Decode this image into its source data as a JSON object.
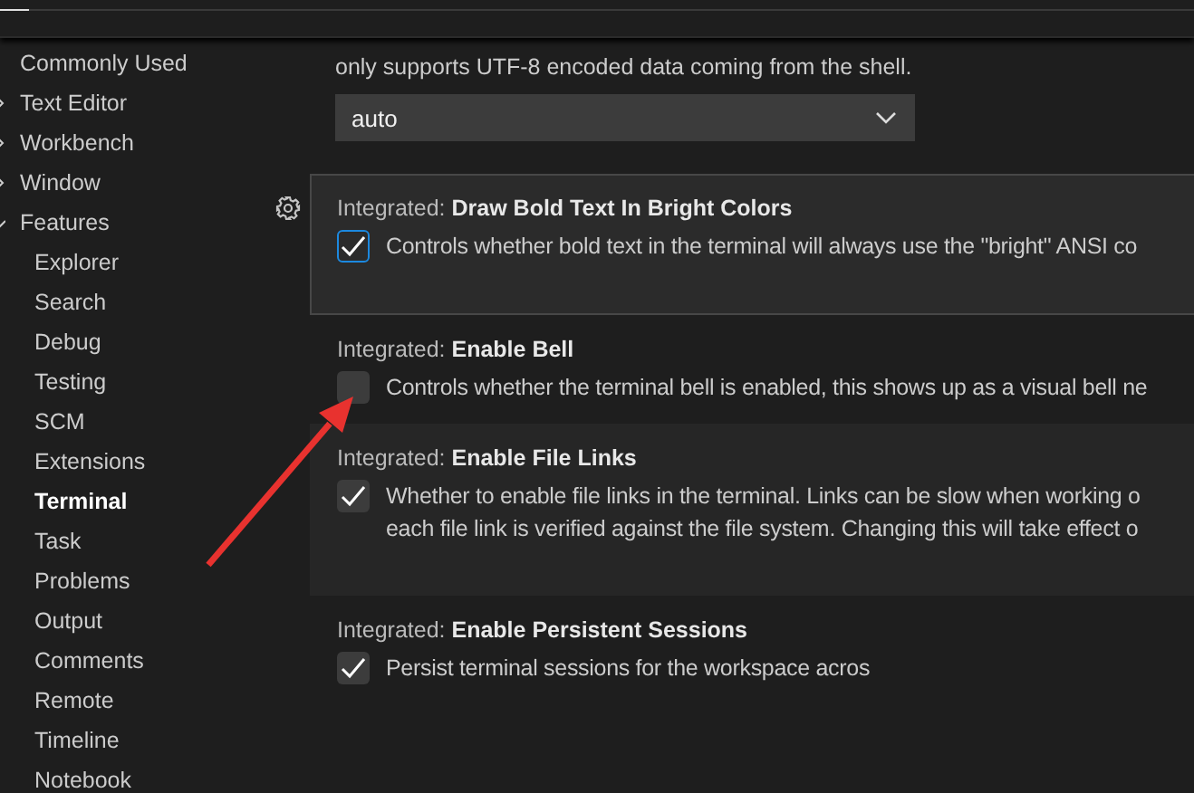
{
  "sidebar": {
    "items": [
      {
        "label": "Commonly Used",
        "kind": "leaf",
        "selected": false
      },
      {
        "label": "Text Editor",
        "kind": "group",
        "expanded": false,
        "selected": false
      },
      {
        "label": "Workbench",
        "kind": "group",
        "expanded": false,
        "selected": false
      },
      {
        "label": "Window",
        "kind": "group",
        "expanded": false,
        "selected": false
      },
      {
        "label": "Features",
        "kind": "group",
        "expanded": true,
        "selected": false,
        "children": [
          {
            "label": "Explorer",
            "selected": false
          },
          {
            "label": "Search",
            "selected": false
          },
          {
            "label": "Debug",
            "selected": false
          },
          {
            "label": "Testing",
            "selected": false
          },
          {
            "label": "SCM",
            "selected": false
          },
          {
            "label": "Extensions",
            "selected": false
          },
          {
            "label": "Terminal",
            "selected": true
          },
          {
            "label": "Task",
            "selected": false
          },
          {
            "label": "Problems",
            "selected": false
          },
          {
            "label": "Output",
            "selected": false
          },
          {
            "label": "Comments",
            "selected": false
          },
          {
            "label": "Remote",
            "selected": false
          },
          {
            "label": "Timeline",
            "selected": false
          },
          {
            "label": "Notebook",
            "selected": false
          }
        ]
      }
    ]
  },
  "previous_setting": {
    "description": "only supports UTF-8 encoded data coming from the shell.",
    "dropdown": {
      "value": "auto"
    }
  },
  "settings": [
    {
      "category": "Integrated: ",
      "name": "Draw Bold Text In Bright Colors",
      "focused": true,
      "hovered": false,
      "checked": true,
      "description_lines": [
        "Controls whether bold text in the terminal will always use the \"bright\" ANSI co"
      ]
    },
    {
      "category": "Integrated: ",
      "name": "Enable Bell",
      "focused": false,
      "hovered": false,
      "checked": false,
      "description_lines": [
        "Controls whether the terminal bell is enabled, this shows up as a visual bell ne"
      ]
    },
    {
      "category": "Integrated: ",
      "name": "Enable File Links",
      "focused": false,
      "hovered": true,
      "checked": true,
      "description_lines": [
        "Whether to enable file links in the terminal. Links can be slow when working o",
        "each file link is verified against the file system. Changing this will take effect o"
      ]
    },
    {
      "category": "Integrated: ",
      "name": "Enable Persistent Sessions",
      "focused": false,
      "hovered": false,
      "checked": true,
      "description_lines": [
        "Persist terminal sessions for the workspace acros"
      ]
    }
  ]
}
